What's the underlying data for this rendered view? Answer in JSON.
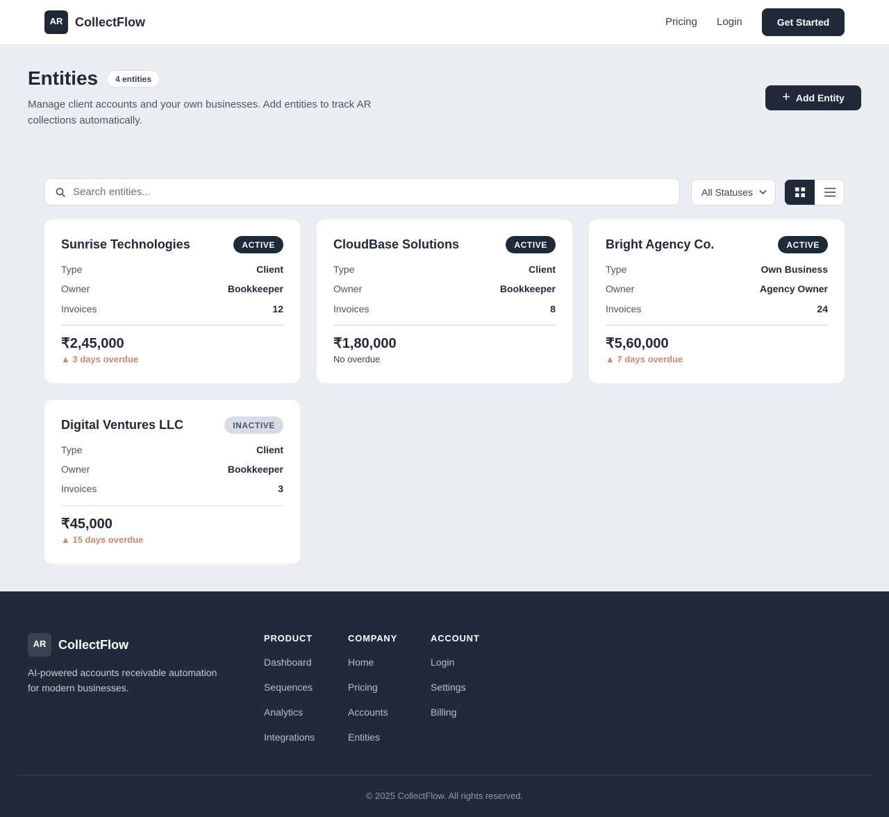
{
  "nav": {
    "logo_text": "AR",
    "brand": "CollectFlow",
    "links": [
      "Pricing",
      "Login"
    ],
    "cta": "Get Started"
  },
  "header": {
    "title": "Entities",
    "count_badge": "4 entities",
    "description": "Manage client accounts and your own businesses. Add entities to track AR collections automatically.",
    "add_button": "Add Entity",
    "add_icon": "+"
  },
  "toolbar": {
    "search_placeholder": "Search entities...",
    "status_filter": "All Statuses",
    "view_modes": [
      "grid",
      "list"
    ],
    "active_view": "grid"
  },
  "labels": {
    "type": "Type",
    "owner": "Owner",
    "invoices": "Invoices"
  },
  "entities": [
    {
      "name": "Sunrise Technologies",
      "status": "ACTIVE",
      "type": "Client",
      "owner": "Bookkeeper",
      "invoices": "12",
      "amount": "₹2,45,000",
      "overdue": "▲ 3 days overdue"
    },
    {
      "name": "CloudBase Solutions",
      "status": "ACTIVE",
      "type": "Client",
      "owner": "Bookkeeper",
      "invoices": "8",
      "amount": "₹1,80,000",
      "overdue": "No overdue"
    },
    {
      "name": "Bright Agency Co.",
      "status": "ACTIVE",
      "type": "Own Business",
      "owner": "Agency Owner",
      "invoices": "24",
      "amount": "₹5,60,000",
      "overdue": "▲ 7 days overdue"
    },
    {
      "name": "Digital Ventures LLC",
      "status": "INACTIVE",
      "type": "Client",
      "owner": "Bookkeeper",
      "invoices": "3",
      "amount": "₹45,000",
      "overdue": "▲ 15 days overdue"
    }
  ],
  "colors": {
    "primary": "#1f2937",
    "background": "#ebeef3",
    "overdue": "#d0866d",
    "footer_bg": "#222938"
  },
  "footer": {
    "logo_text": "AR",
    "brand": "CollectFlow",
    "tagline": "AI-powered accounts receivable automation for modern businesses.",
    "columns": [
      {
        "heading": "PRODUCT",
        "links": [
          "Dashboard",
          "Sequences",
          "Analytics",
          "Integrations"
        ]
      },
      {
        "heading": "COMPANY",
        "links": [
          "Home",
          "Pricing",
          "Accounts",
          "Entities"
        ]
      },
      {
        "heading": "ACCOUNT",
        "links": [
          "Login",
          "Settings",
          "Billing"
        ]
      }
    ],
    "copyright": "© 2025 CollectFlow. All rights reserved."
  }
}
